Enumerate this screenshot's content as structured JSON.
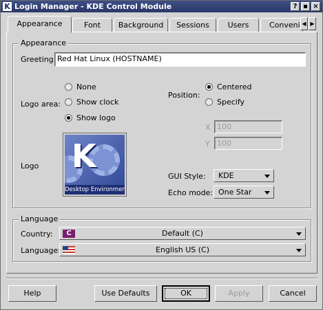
{
  "window": {
    "title": "Login Manager - KDE Control Module",
    "app_icon": "K",
    "buttons": [
      "?",
      "▪",
      "×"
    ]
  },
  "tabs": [
    {
      "label": "Appearance",
      "active": true
    },
    {
      "label": "Font"
    },
    {
      "label": "Background"
    },
    {
      "label": "Sessions"
    },
    {
      "label": "Users"
    },
    {
      "label": "Convenience"
    }
  ],
  "tab_scroll": {
    "left": "◀",
    "right": "▶"
  },
  "appearance": {
    "group_title": "Appearance",
    "greeting_label": "Greeting:",
    "greeting_value": "Red Hat Linux (HOSTNAME)",
    "logo_area_label": "Logo area:",
    "logo_area_options": [
      {
        "label": "None",
        "checked": false
      },
      {
        "label": "Show clock",
        "checked": false
      },
      {
        "label": "Show logo",
        "checked": true
      }
    ],
    "position_label": "Position:",
    "position_options": [
      {
        "label": "Centered",
        "checked": true
      },
      {
        "label": "Specify",
        "checked": false
      }
    ],
    "x_label": "X",
    "x_value": "100",
    "y_label": "Y",
    "y_value": "100",
    "logo_label": "Logo",
    "logo_letter": "K",
    "logo_caption": "Desktop Environment",
    "gui_style_label": "GUI Style:",
    "gui_style_value": "KDE",
    "echo_mode_label": "Echo mode:",
    "echo_mode_value": "One Star"
  },
  "language": {
    "group_title": "Language",
    "country_label": "Country:",
    "country_flag": "C",
    "country_value": "Default (C)",
    "language_label": "Language:",
    "language_value": "English US (C)"
  },
  "footer": {
    "help": "Help",
    "use_defaults": "Use Defaults",
    "ok": "OK",
    "apply": "Apply",
    "cancel": "Cancel"
  }
}
